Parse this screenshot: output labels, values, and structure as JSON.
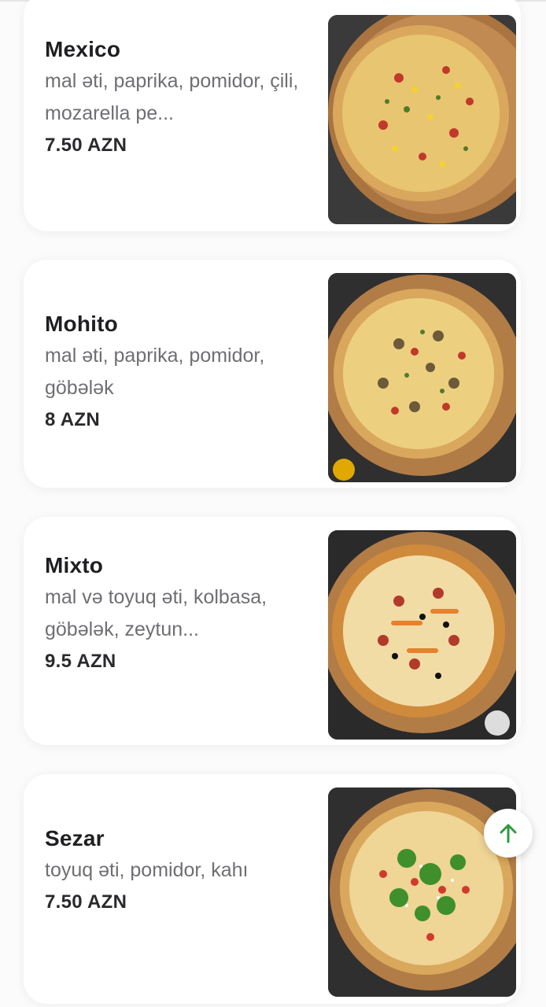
{
  "accent_color": "#2e9b3e",
  "menu": {
    "items": [
      {
        "name": "Mexico",
        "description": "mal əti, paprika, pomidor, çili, mozarella pe...",
        "price": "7.50 AZN",
        "image_icon": "pizza-mexico-image"
      },
      {
        "name": "Mohito",
        "description": "mal əti, paprika, pomidor, göbələk",
        "price": "8 AZN",
        "image_icon": "pizza-mohito-image"
      },
      {
        "name": "Mixto",
        "description": "mal və toyuq əti, kolbasa, göbələk, zeytun...",
        "price": "9.5 AZN",
        "image_icon": "pizza-mixto-image"
      },
      {
        "name": "Sezar",
        "description": "toyuq əti, pomidor, kahı",
        "price": "7.50 AZN",
        "image_icon": "pizza-sezar-image"
      }
    ]
  },
  "scroll_top": {
    "icon": "arrow-up-icon"
  }
}
